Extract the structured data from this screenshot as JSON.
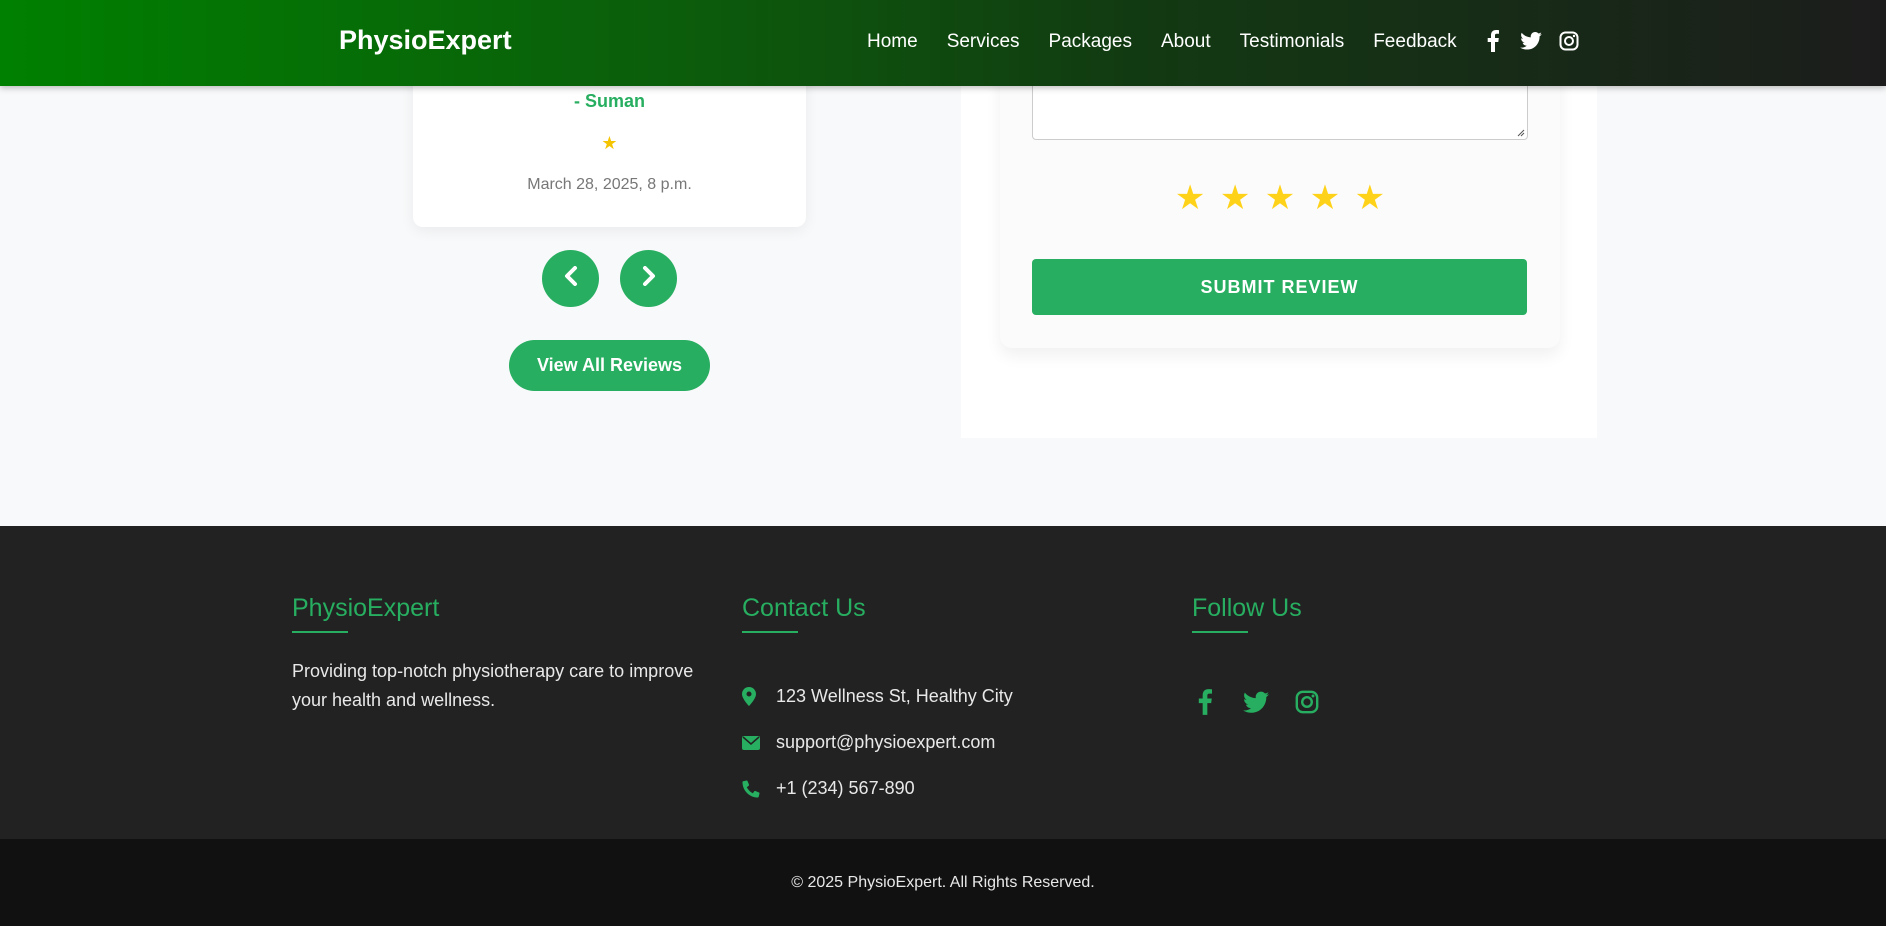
{
  "navbar": {
    "brand": "PhysioExpert",
    "links": [
      "Home",
      "Services",
      "Packages",
      "About",
      "Testimonials",
      "Feedback"
    ],
    "social_icons": [
      "facebook-icon",
      "twitter-icon",
      "instagram-icon"
    ]
  },
  "testimonial": {
    "author": "- Suman",
    "rating_stars": "★",
    "rating_value": 1,
    "date": "March 28, 2025, 8 p.m."
  },
  "carousel": {
    "prev_icon": "chevron-left-icon",
    "next_icon": "chevron-right-icon"
  },
  "view_all_label": "View All Reviews",
  "review_form": {
    "stars": [
      "★",
      "★",
      "★",
      "★",
      "★"
    ],
    "submit_label": "SUBMIT REVIEW"
  },
  "footer": {
    "about": {
      "title": "PhysioExpert",
      "text": "Providing top-notch physiotherapy care to improve your health and wellness."
    },
    "contact": {
      "title": "Contact Us",
      "address": "123 Wellness St, Healthy City",
      "email": "support@physioexpert.com",
      "phone": "+1 (234) 567-890"
    },
    "follow": {
      "title": "Follow Us",
      "icons": [
        "facebook-icon",
        "twitter-icon",
        "instagram-icon"
      ]
    },
    "copyright": "© 2025 PhysioExpert. All Rights Reserved."
  },
  "colors": {
    "accent": "#27ae60",
    "star": "#ffd21a",
    "nav_gradient_start": "#008000",
    "nav_gradient_end": "#1c1c1c",
    "footer_bg": "#222222",
    "bottom_bar_bg": "#111111"
  }
}
